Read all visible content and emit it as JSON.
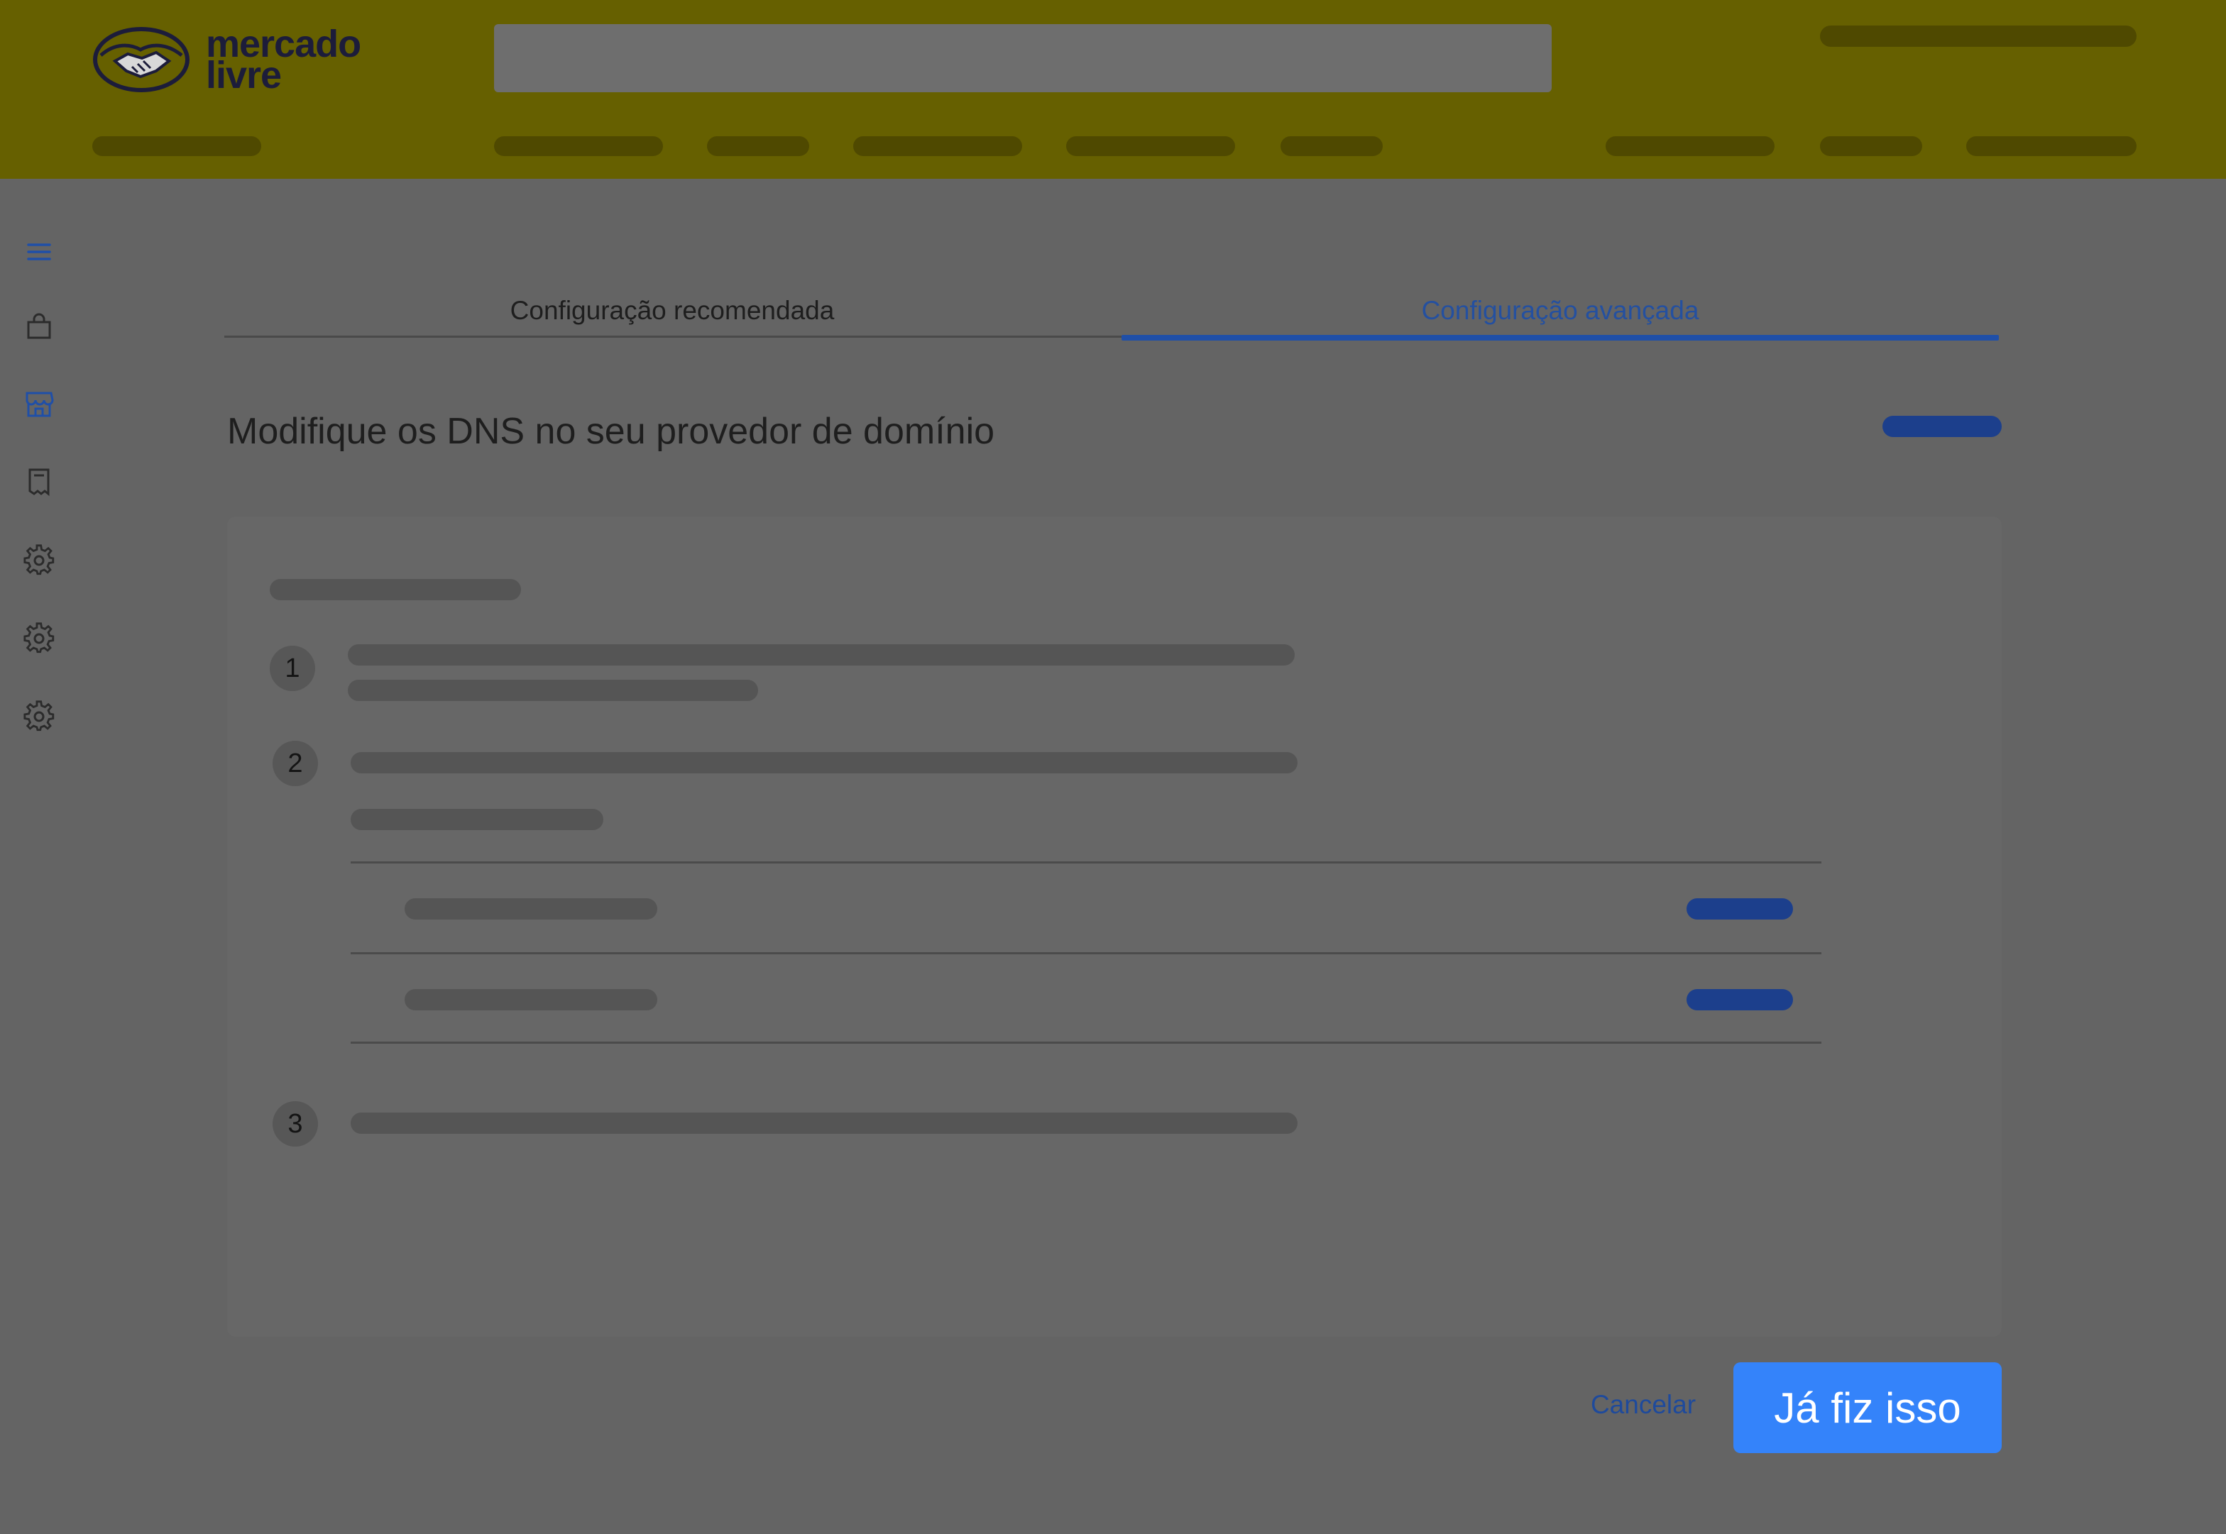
{
  "brand": {
    "logo_line1": "mercado",
    "logo_line2": "livre",
    "colors": {
      "header": "#666000",
      "accent_blue": "#3483fa",
      "link_blue": "#2450a0"
    }
  },
  "sidebar": {
    "icons": [
      "menu-icon",
      "shopping-bag-icon",
      "store-icon",
      "receipt-icon",
      "gear-icon",
      "gear-icon",
      "gear-icon"
    ]
  },
  "tabs": [
    {
      "label": "Configuração recomendada",
      "active": false
    },
    {
      "label": "Configuração avançada",
      "active": true
    }
  ],
  "page": {
    "title": "Modifique os DNS no seu provedor de domínio"
  },
  "steps": [
    {
      "number": "1"
    },
    {
      "number": "2"
    },
    {
      "number": "3"
    }
  ],
  "actions": {
    "cancel_label": "Cancelar",
    "confirm_label": "Já fiz isso"
  }
}
